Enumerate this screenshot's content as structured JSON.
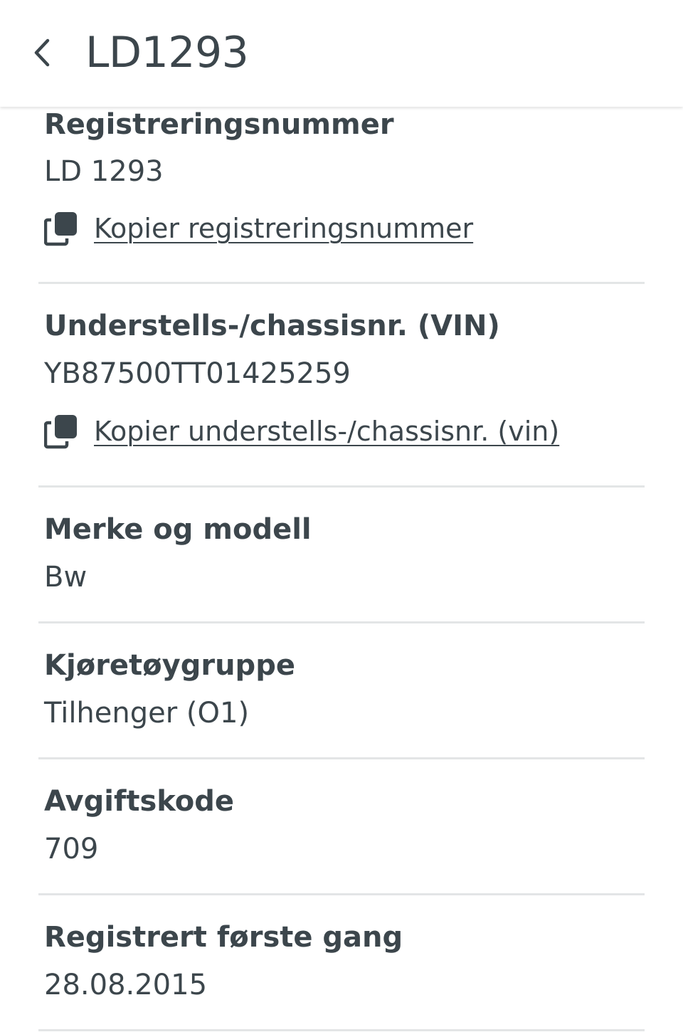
{
  "header": {
    "title": "LD1293"
  },
  "fields": {
    "registration": {
      "label": "Registreringsnummer",
      "value": "LD 1293",
      "copy_label": "Kopier registreringsnummer"
    },
    "vin": {
      "label": "Understells-/chassisnr. (VIN)",
      "value": "YB87500TT01425259",
      "copy_label": "Kopier understells-/chassisnr. (vin)"
    },
    "make_model": {
      "label": "Merke og modell",
      "value": "Bw"
    },
    "vehicle_group": {
      "label": "Kjøretøygruppe",
      "value": "Tilhenger (O1)"
    },
    "tax_code": {
      "label": "Avgiftskode",
      "value": "709"
    },
    "first_registered": {
      "label": "Registrert første gang",
      "value": "28.08.2015"
    }
  },
  "icons": {
    "back": "chevron-left-icon",
    "copy": "copy-icon"
  },
  "colors": {
    "text": "#3c464c",
    "divider": "#e3e5e6",
    "background": "#ffffff"
  }
}
